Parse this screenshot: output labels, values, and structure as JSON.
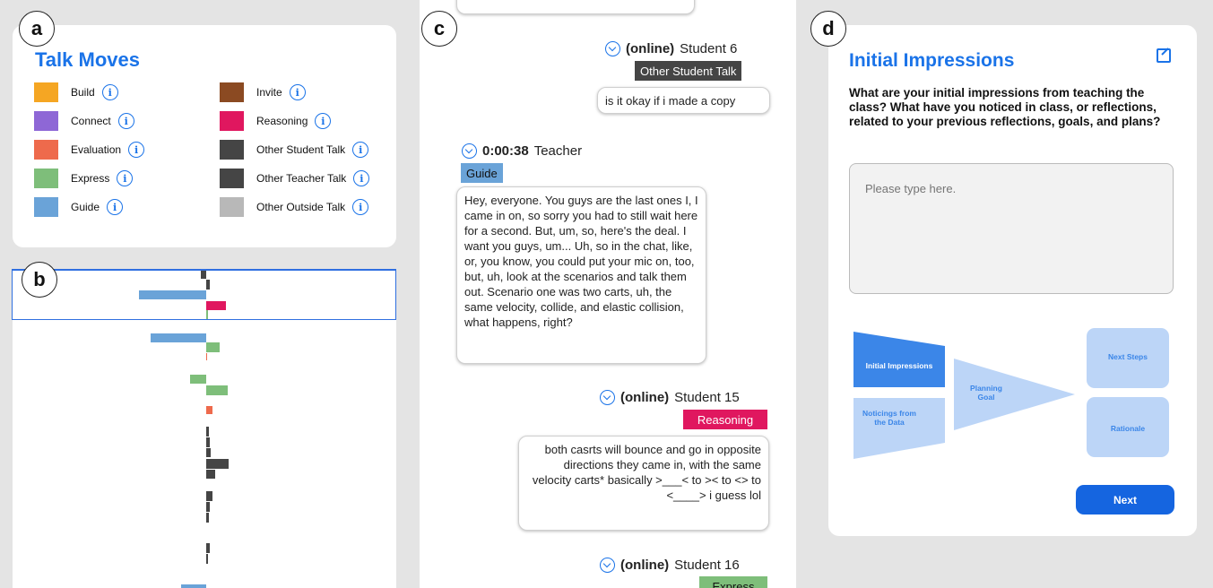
{
  "panels": {
    "a": "a",
    "b": "b",
    "c": "c",
    "d": "d"
  },
  "talk_moves": {
    "title": "Talk Moves",
    "items": [
      {
        "label": "Build",
        "color": "#f5a623"
      },
      {
        "label": "Connect",
        "color": "#8e67d6"
      },
      {
        "label": "Evaluation",
        "color": "#ee6a4c"
      },
      {
        "label": "Express",
        "color": "#7ebe7a"
      },
      {
        "label": "Guide",
        "color": "#6aa3d8"
      },
      {
        "label": "Invite",
        "color": "#8b4a22"
      },
      {
        "label": "Reasoning",
        "color": "#e0175f"
      },
      {
        "label": "Other Student Talk",
        "color": "#454545"
      },
      {
        "label": "Other Teacher Talk",
        "color": "#454545"
      },
      {
        "label": "Other Outside Talk",
        "color": "#b8b8b8"
      }
    ]
  },
  "timeline": {
    "bars": [
      {
        "move": "Other Student Talk",
        "side": "left",
        "length": 6
      },
      {
        "move": "Other Student Talk",
        "side": "right",
        "length": 4
      },
      {
        "move": "Guide",
        "side": "left",
        "length": 75
      },
      {
        "move": "Reasoning",
        "side": "right",
        "length": 22
      },
      {
        "move": "Express",
        "side": "right",
        "length": 2
      },
      {
        "move": "Guide",
        "side": "left",
        "length": 62
      },
      {
        "move": "Express",
        "side": "right",
        "length": 15
      },
      {
        "move": "Evaluation",
        "side": "right",
        "length": 1
      },
      {
        "move": "Express",
        "side": "left",
        "length": 18
      },
      {
        "move": "Express",
        "side": "right",
        "length": 24
      },
      {
        "move": "Evaluation",
        "side": "right",
        "length": 7
      },
      {
        "move": "Other Student Talk",
        "side": "right",
        "length": 3
      },
      {
        "move": "Other Student Talk",
        "side": "right",
        "length": 4
      },
      {
        "move": "Other Student Talk",
        "side": "right",
        "length": 5
      },
      {
        "move": "Other Student Talk",
        "side": "right",
        "length": 25
      },
      {
        "move": "Other Student Talk",
        "side": "right",
        "length": 10
      },
      {
        "move": "Other Student Talk",
        "side": "right",
        "length": 7
      },
      {
        "move": "Other Student Talk",
        "side": "right",
        "length": 4
      },
      {
        "move": "Other Student Talk",
        "side": "right",
        "length": 3
      },
      {
        "move": "Other Student Talk",
        "side": "right",
        "length": 4
      },
      {
        "move": "Other Student Talk",
        "side": "right",
        "length": 2
      },
      {
        "move": "Guide",
        "side": "left",
        "length": 28
      }
    ]
  },
  "transcript": {
    "messages": [
      {
        "status": "(online)",
        "speaker": "Student 6",
        "tag": "Other Student Talk",
        "tag_color": "#454545",
        "text": "is it okay if i made a copy"
      },
      {
        "status": "0:00:38",
        "speaker": "Teacher",
        "tag": "Guide",
        "tag_color": "#6aa3d8",
        "text": "Hey, everyone. You guys are the last ones I, I came in on, so sorry you had to still wait here for a second. But, um, so, here's the deal. I want you guys, um... Uh, so in the chat, like, or, you know, you could put your mic on, too, but, uh, look at the scenarios and talk them out. Scenario one was two carts, uh, the same velocity, collide, and elastic collision, what happens, right?"
      },
      {
        "status": "(online)",
        "speaker": "Student 15",
        "tag": "Reasoning",
        "tag_color": "#e0175f",
        "text": "both casrts will bounce and go in opposite directions they came in, with the same velocity carts* basically >___< to >< to <> to <____> i guess lol"
      },
      {
        "status": "(online)",
        "speaker": "Student 16",
        "tag": "Express",
        "tag_color": "#7ebe7a",
        "text": ""
      }
    ]
  },
  "reflection": {
    "title": "Initial Impressions",
    "question": "What are your initial impressions from teaching the class? What have you noticed in class, or reflections, related to your previous reflections, goals, and plans?",
    "placeholder": "Please type here.",
    "next_label": "Next",
    "flow": {
      "initial": "Initial Impressions",
      "noticings": "Noticings from the Data",
      "planning": "Planning Goal",
      "next_steps": "Next Steps",
      "rationale": "Rationale"
    }
  }
}
